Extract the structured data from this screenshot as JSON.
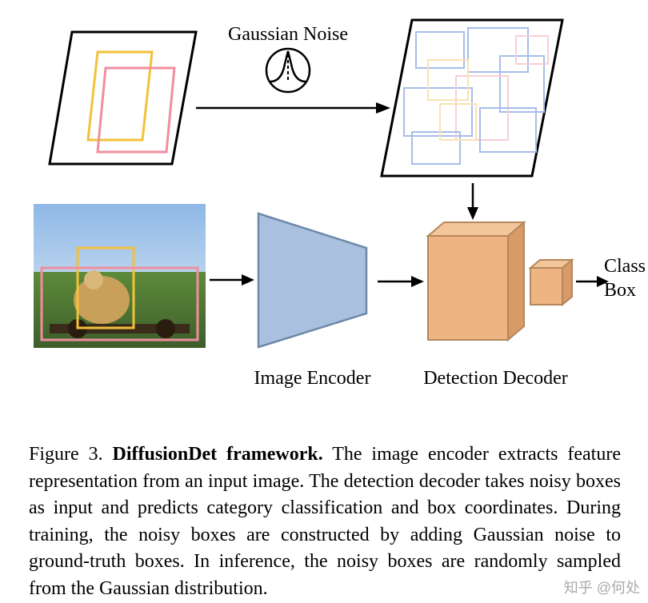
{
  "labels": {
    "gaussian_noise": "Gaussian Noise",
    "image_encoder": "Image Encoder",
    "detection_decoder": "Detection Decoder",
    "output_class": "Class",
    "output_box": "Box"
  },
  "caption": {
    "prefix": "Figure 3.",
    "title": "DiffusionDet framework.",
    "body": "The image encoder extracts feature representation from an input image. The detection decoder takes noisy boxes as input and predicts category classification and box coordinates. During training, the noisy boxes are constructed by adding Gaussian noise to ground-truth boxes. In inference, the noisy boxes are randomly sampled from the Gaussian distribution."
  },
  "watermark": "知乎 @何处"
}
